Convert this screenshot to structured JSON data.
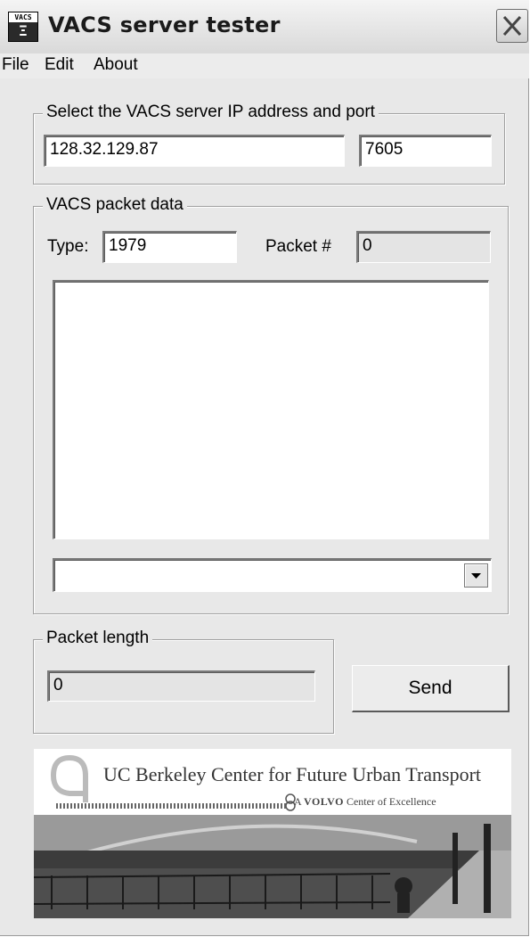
{
  "window": {
    "title": "VACS server tester"
  },
  "menu": {
    "items": [
      "File",
      "Edit",
      "About"
    ]
  },
  "server": {
    "group_label": "Select the VACS server IP address and port",
    "ip_value": "128.32.129.87",
    "port_value": "7605"
  },
  "packet": {
    "group_label": "VACS packet data",
    "type_label": "Type:",
    "type_value": "1979",
    "packet_num_label": "Packet #",
    "packet_num_value": "0",
    "data_value": "",
    "combo_value": ""
  },
  "length": {
    "group_label": "Packet length",
    "value": "0"
  },
  "send_label": "Send",
  "banner": {
    "title": "UC Berkeley Center for Future Urban Transport",
    "sub_prefix": "A",
    "sub_brand": "VOLVO",
    "sub_suffix": "Center of Excellence"
  }
}
